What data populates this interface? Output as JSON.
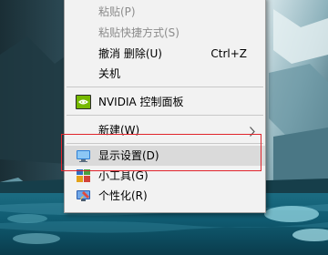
{
  "context_menu": {
    "items": [
      {
        "label": "粘贴(P)",
        "enabled": false
      },
      {
        "label": "粘贴快捷方式(S)",
        "enabled": false
      },
      {
        "label": "撤消 删除(U)",
        "shortcut": "Ctrl+Z",
        "enabled": true
      },
      {
        "label": "关机",
        "enabled": true
      },
      {
        "label": "NVIDIA 控制面板",
        "icon": "nvidia-icon",
        "enabled": true
      },
      {
        "label": "新建(W)",
        "has_submenu": true,
        "enabled": true
      },
      {
        "label": "显示设置(D)",
        "icon": "display-settings-icon",
        "enabled": true,
        "highlighted": true
      },
      {
        "label": "小工具(G)",
        "icon": "gadgets-icon",
        "enabled": true
      },
      {
        "label": "个性化(R)",
        "icon": "personalize-icon",
        "enabled": true
      }
    ]
  },
  "colors": {
    "menu_background": "#f2f2f2",
    "highlight": "#dadada",
    "disabled_text": "#8c8c8c",
    "annotation": "#e0242b"
  }
}
